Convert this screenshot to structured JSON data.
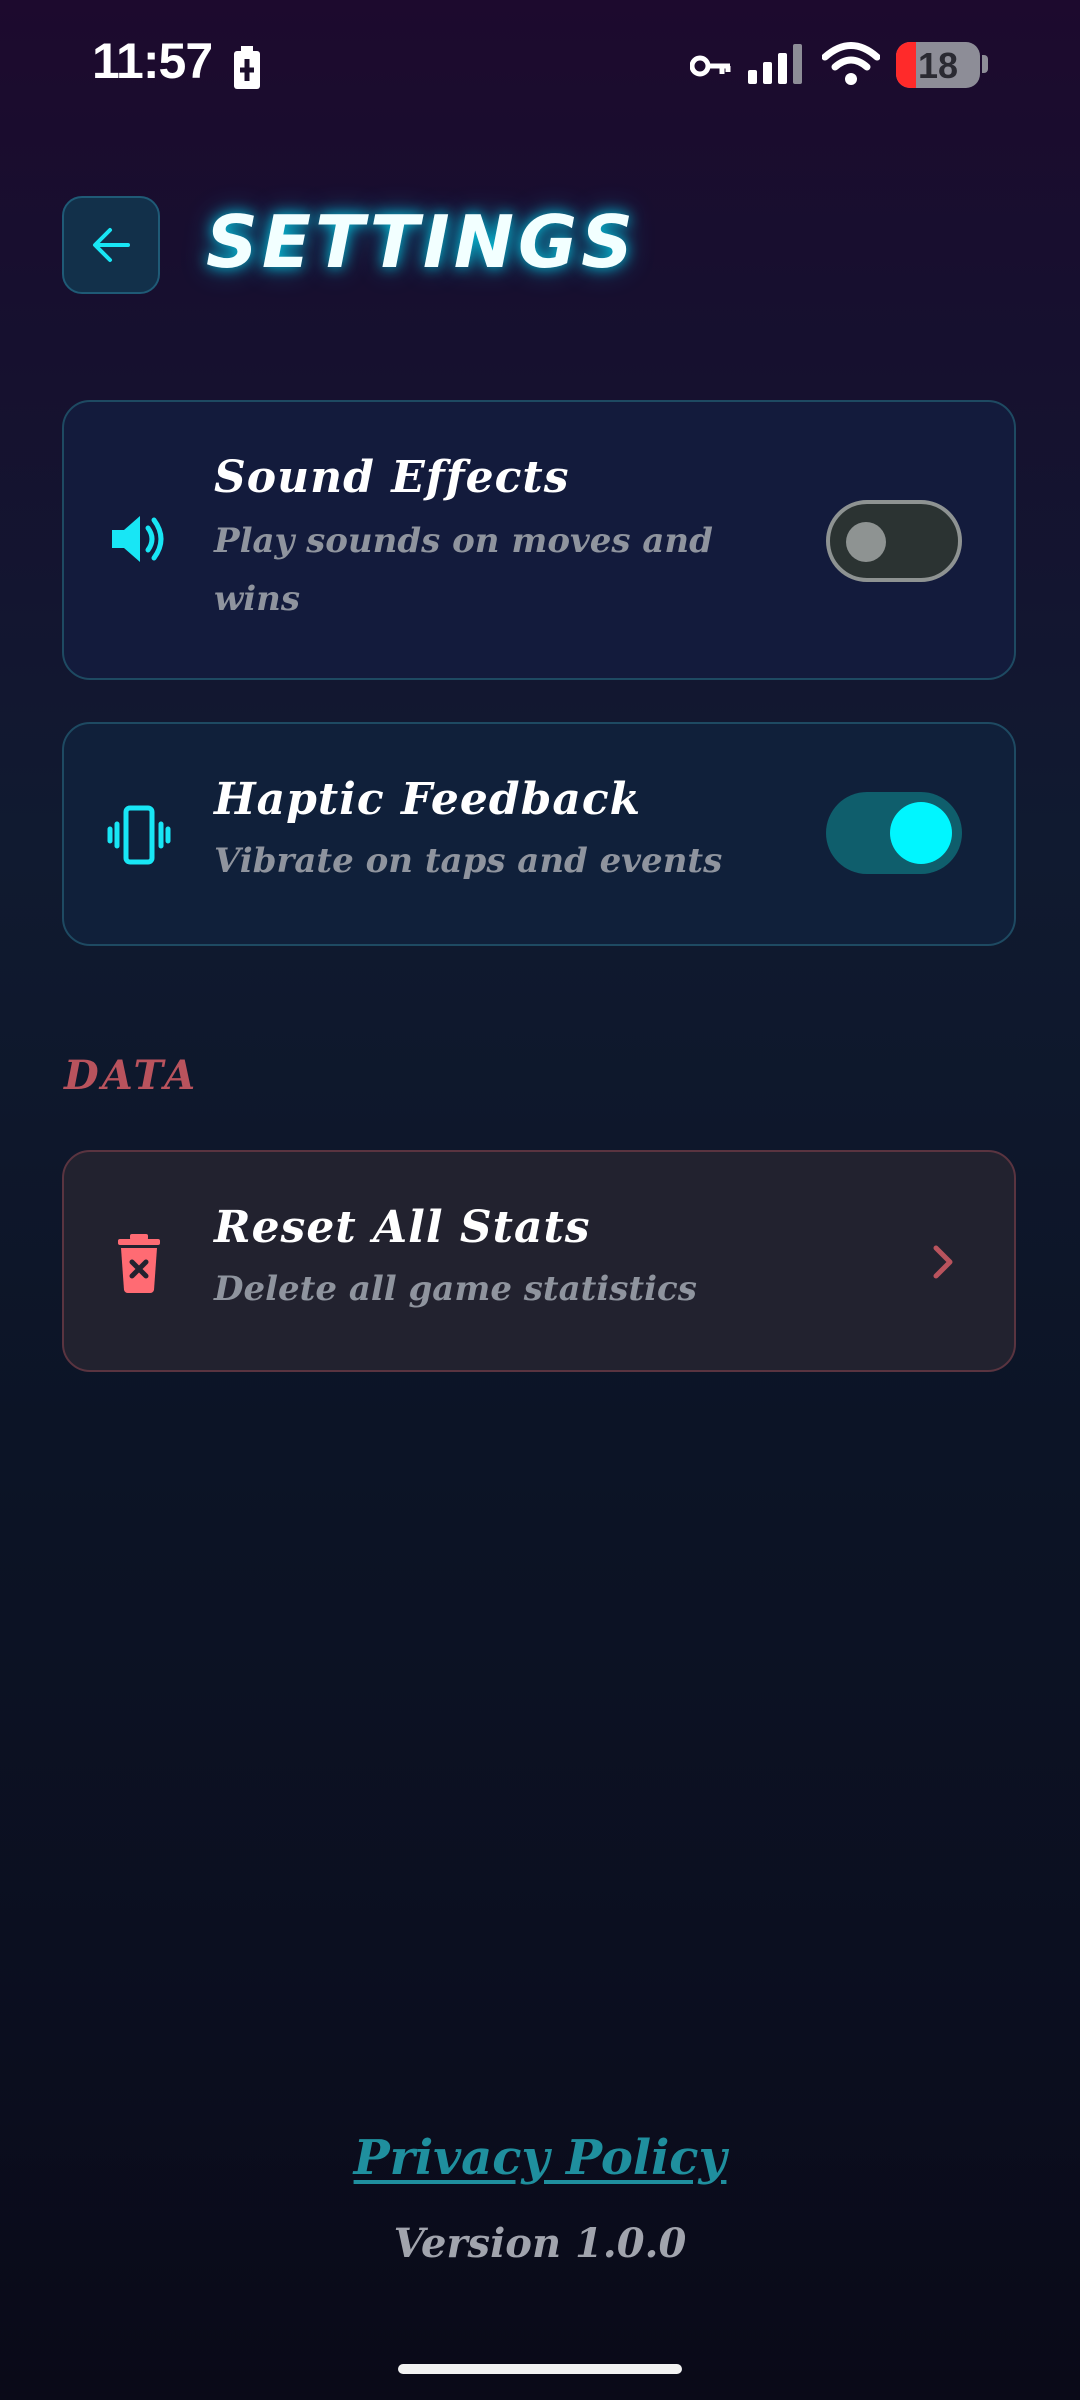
{
  "status_bar": {
    "time": "11:57",
    "battery_level": "18",
    "icons": [
      "charging-icon",
      "key-icon",
      "signal-icon",
      "wifi-icon",
      "battery-icon"
    ]
  },
  "header": {
    "back_icon": "arrow-left-icon",
    "title": "SETTINGS"
  },
  "settings": [
    {
      "icon": "volume-icon",
      "title": "Sound Effects",
      "description": "Play sounds on moves and wins",
      "description_lines": [
        "Play sounds on moves and",
        "wins"
      ],
      "enabled": false
    },
    {
      "icon": "vibrate-icon",
      "title": "Haptic Feedback",
      "description": "Vibrate on taps and events",
      "enabled": true
    }
  ],
  "data_section": {
    "label": "DATA",
    "reset": {
      "icon": "trash-icon",
      "title": "Reset All Stats",
      "description": "Delete all game statistics",
      "chevron": "chevron-right-icon"
    }
  },
  "footer": {
    "privacy_link": "Privacy Policy",
    "version": "Version 1.0.0"
  },
  "colors": {
    "accent": "#00f6ff",
    "danger": "#ff6b73",
    "section_label": "#b9535d",
    "link": "#1f8f9e"
  }
}
